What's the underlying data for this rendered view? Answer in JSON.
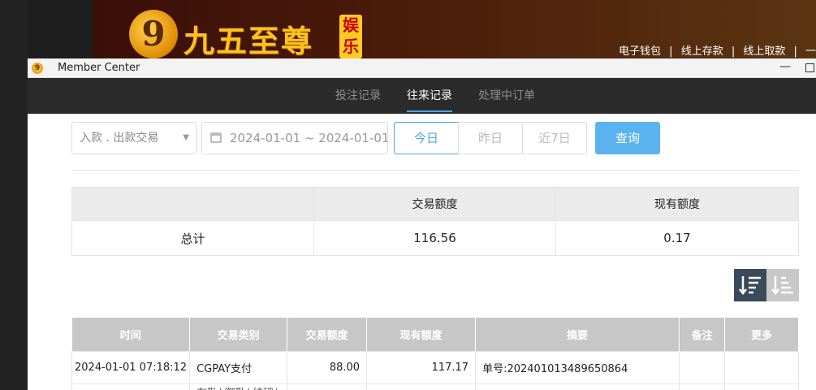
{
  "site": {
    "logo_mark": "9",
    "logo_text": "九五至尊",
    "logo_tag": "娱乐",
    "top_links": [
      "电子钱包",
      "|",
      "线上存款",
      "|",
      "线上取款",
      "|",
      "一键归"
    ]
  },
  "window": {
    "title": "Member Center",
    "minimize_glyph": "—"
  },
  "tabs": [
    {
      "label": "投注记录",
      "active": false
    },
    {
      "label": "往来记录",
      "active": true
    },
    {
      "label": "处理中订单",
      "active": false
    }
  ],
  "filters": {
    "type_value": "入款 . 出款交易",
    "date_range": "2024-01-01 ~ 2024-01-01",
    "quick": [
      "今日",
      "昨日",
      "近7日"
    ],
    "quick_selected": "今日",
    "query_label": "查询"
  },
  "summary": {
    "headers": [
      "",
      "交易额度",
      "现有额度"
    ],
    "row": [
      "总计",
      "116.56",
      "0.17"
    ]
  },
  "records": {
    "headers": [
      "时间",
      "交易类别",
      "交易额度",
      "现有额度",
      "摘要",
      "备注",
      "更多"
    ],
    "rows": [
      {
        "time": "2024-01-01 07:18:12",
        "type": "CGPAY支付",
        "amount": "88.00",
        "balance": "117.17",
        "summary": "单号:202401013489650864",
        "note": "",
        "more": ""
      },
      {
        "time": "",
        "type": "有勒/ 御勒/ 结砰/",
        "amount": "",
        "balance": "",
        "summary": "",
        "note": "",
        "more": ""
      }
    ]
  },
  "colors": {
    "accent": "#4aa8e8",
    "tab_bar": "#2b2b2b",
    "table_header": "#c7c7c7"
  }
}
